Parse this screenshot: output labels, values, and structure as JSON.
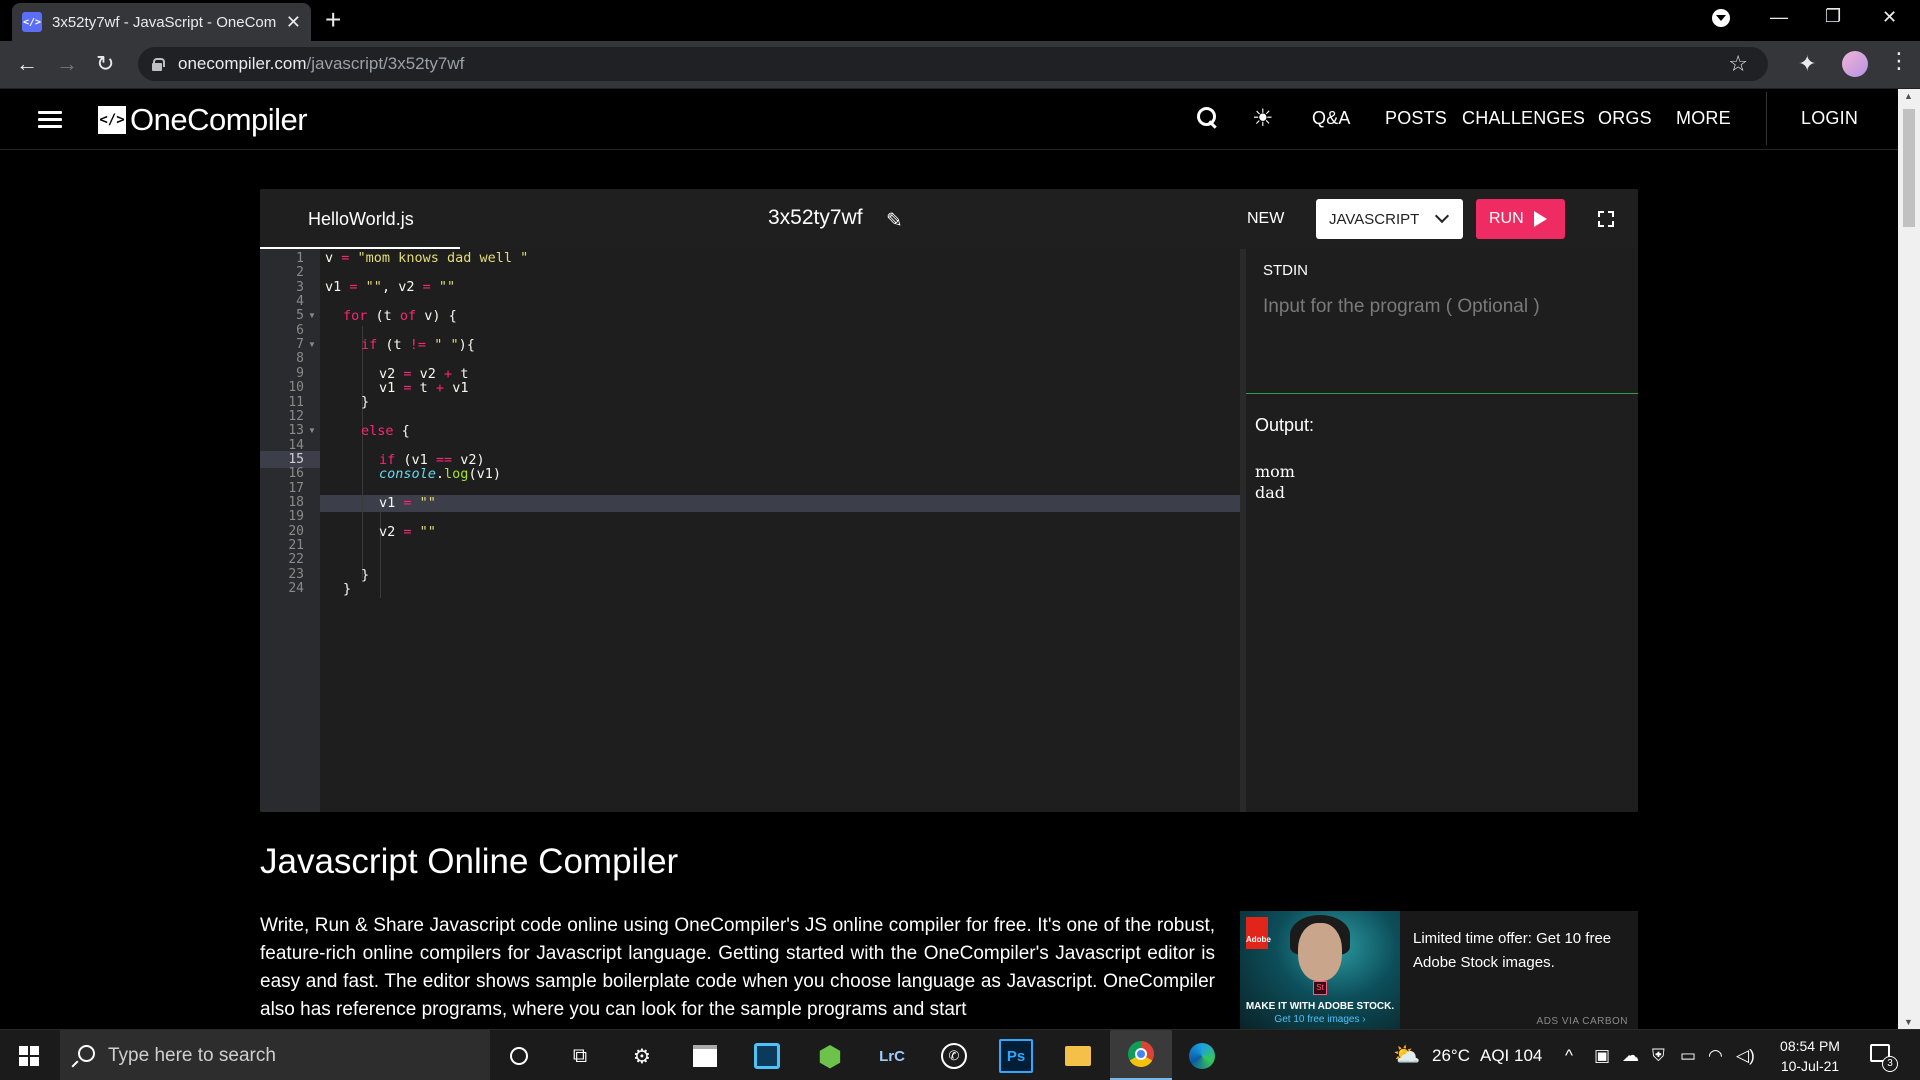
{
  "browser": {
    "tab_title": "3x52ty7wf - JavaScript - OneCom",
    "tab_favicon": "</>",
    "url_host": "onecompiler.com",
    "url_path": "/javascript/3x52ty7wf"
  },
  "site": {
    "logo_mark": "</>",
    "logo_text": "OneCompiler",
    "nav": [
      "Q&A",
      "POSTS",
      "CHALLENGES",
      "ORGS",
      "MORE"
    ],
    "login": "LOGIN"
  },
  "editor": {
    "file_name": "HelloWorld.js",
    "title": "3x52ty7wf",
    "new_label": "NEW",
    "language": "JAVASCRIPT",
    "run_label": "RUN",
    "line_numbers": [
      "1",
      "2",
      "3",
      "4",
      "5",
      "6",
      "7",
      "8",
      "9",
      "10",
      "11",
      "12",
      "13",
      "14",
      "15",
      "16",
      "17",
      "18",
      "19",
      "20",
      "21",
      "22",
      "23",
      "24"
    ],
    "highlighted_line": 15,
    "fold_lines": [
      5,
      7,
      13
    ]
  },
  "stdin": {
    "label": "STDIN",
    "placeholder": "Input for the program ( Optional )"
  },
  "output": {
    "label": "Output:",
    "lines": [
      "mom",
      "dad"
    ]
  },
  "content": {
    "heading": "Javascript Online Compiler",
    "paragraph": "Write, Run & Share Javascript code online using OneCompiler's JS online compiler for free. It's one of the robust, feature-rich online compilers for Javascript language. Getting started with the OneCompiler's Javascript editor is easy and fast. The editor shows sample boilerplate code when you choose language as Javascript. OneCompiler also has reference programs, where you can look for the sample programs and start"
  },
  "ad": {
    "brand_mark": "Adobe",
    "stock_mark": "St",
    "caption_main": "MAKE IT WITH ADOBE STOCK.",
    "caption_cta": "Get 10 free images ›",
    "text": "Limited time offer: Get 10 free Adobe Stock images.",
    "via": "ADS VIA CARBON"
  },
  "taskbar": {
    "search_placeholder": "Type here to search",
    "apps": [
      "cortana-icon",
      "task-view-icon",
      "settings-icon",
      "store-icon",
      "app-icon",
      "node-icon",
      "lightroom-icon",
      "whatsapp-icon",
      "photoshop-icon",
      "file-explorer-icon",
      "chrome-icon",
      "edge-icon"
    ],
    "lightroom_label": "LrC",
    "photoshop_label": "Ps",
    "temperature": "26°C",
    "aqi": "AQI 104",
    "time": "08:54 PM",
    "date": "10-Jul-21",
    "notification_count": "3"
  },
  "colors": {
    "run_button": "#ef2b63",
    "stdin_divider": "#2e9e4f",
    "editor_bg": "#1e1e1e"
  }
}
